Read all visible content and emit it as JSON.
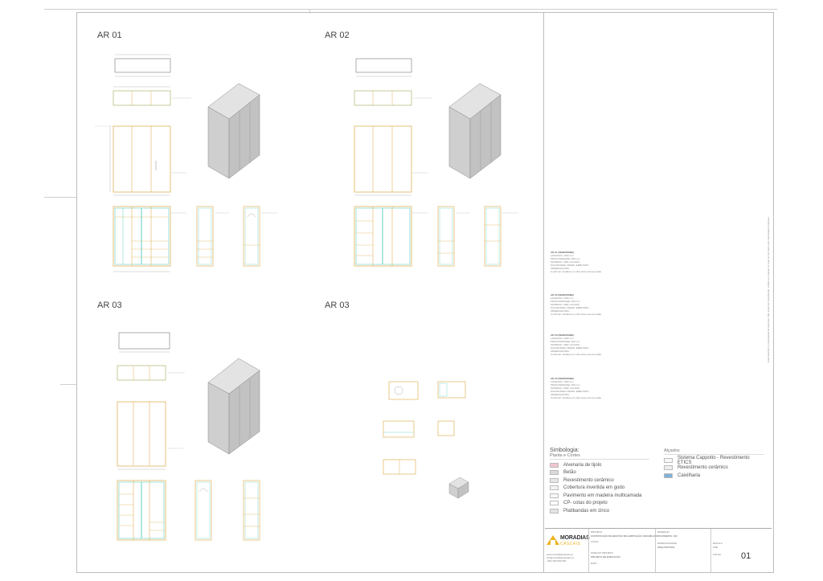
{
  "sheet": {
    "sections": [
      {
        "title": "AR 01"
      },
      {
        "title": "AR 02"
      },
      {
        "title": "AR 03"
      },
      {
        "title": "AR 03"
      }
    ],
    "spec_notes": [
      {
        "heading": "AR 01 (WARDROBE)",
        "lines": [
          "LARGURA: 2400 mm",
          "PROFUNDIDADE: 600 mm",
          "MATERIAL: MDF LACADO",
          "PUXADORES: PERFIL EMBUTIDO",
          "OBSERVAÇÕES:",
          "Confirmar medidas em obra antes da execução."
        ]
      },
      {
        "heading": "AR 02 (WARDROBE)",
        "lines": [
          "LARGURA: 2400 mm",
          "PROFUNDIDADE: 600 mm",
          "MATERIAL: MDF LACADO",
          "PUXADORES: PERFIL EMBUTIDO",
          "OBSERVAÇÕES:",
          "Confirmar medidas em obra antes da execução."
        ]
      },
      {
        "heading": "AR 03 (WARDROBE)",
        "lines": [
          "LARGURA: 2400 mm",
          "PROFUNDIDADE: 600 mm",
          "MATERIAL: MDF LACADO",
          "PUXADORES: PERFIL EMBUTIDO",
          "OBSERVAÇÕES:",
          "Confirmar medidas em obra antes da execução."
        ]
      },
      {
        "heading": "AR 03 (WARDROBE)",
        "lines": [
          "LARGURA: 1200 mm",
          "PROFUNDIDADE: 600 mm",
          "MATERIAL: MDF LACADO",
          "PUXADORES: PERFIL EMBUTIDO",
          "OBSERVAÇÕES:",
          "Confirmar medidas em obra antes da execução."
        ]
      }
    ]
  },
  "legend": {
    "title": "Simbologia:",
    "group_left": "Planta e Cortes",
    "group_right": "Alçados",
    "left_items": [
      {
        "label": "Alvenaria de tijolo",
        "color": "#f2c6cf"
      },
      {
        "label": "Betão",
        "color": "#d9d9d9"
      },
      {
        "label": "Revestimento cerâmico",
        "color": "#e6e6e6"
      },
      {
        "label": "Cobertura invertida em godo",
        "color": "#f4f4f4"
      },
      {
        "label": "Pavimento em madeira multicamada",
        "color": "#f7f7f7"
      },
      {
        "label": "CP- cotas do projeto",
        "color": "#ffffff"
      },
      {
        "label": "Platibandas em zinco",
        "color": "#e3e3e3"
      }
    ],
    "right_items": [
      {
        "label": "Sistema Cappotto - Revestimento ETICS",
        "color": "#f7f7f7"
      },
      {
        "label": "Revestimento cerâmico",
        "color": "#eeeeee"
      },
      {
        "label": "Caixilharia",
        "color": "#7fb2da"
      }
    ]
  },
  "titleblock": {
    "brand": "MORADIAS",
    "brand_sub": "CASCAIS",
    "project_label": "PROJETO",
    "project_value": "CONSTRUÇÃO DE EDIFÍCIO DE HABITAÇÃO UNIFAMILIAR",
    "place_label": "LOCAL",
    "drawing_label": "DESENHO",
    "drawing_value": "ROUPEIROS / AR",
    "specialty_label": "ESPECIALIDADE",
    "specialty_value": "ARQUITETURA",
    "scale_label": "ESCALA",
    "scale_value": "1:50",
    "sheet_label": "FOLHA",
    "sheet_number": "01",
    "date_label": "DATA",
    "phase_label": "FASE DO PROJETO",
    "phase_value": "PROJETO DE EXECUÇÃO",
    "contact_lines": [
      "www.moradiascascais.pt",
      "info@moradiascascais.pt",
      "+351 000 000 000"
    ],
    "vertical_note": "Este desenho é propriedade da empresa. Não pode ser reproduzido, cedido ou copiado no todo ou em parte sem autorização expressa."
  }
}
